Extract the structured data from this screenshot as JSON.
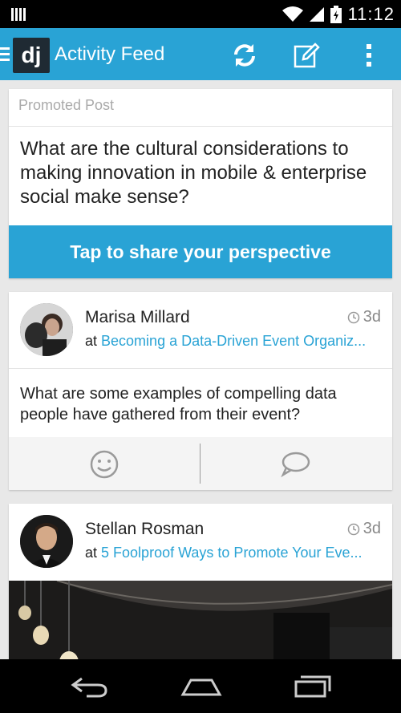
{
  "status_bar": {
    "time": "11:12",
    "icons": [
      "signal-bars-icon",
      "wifi-icon",
      "cellular-signal-icon",
      "battery-icon"
    ]
  },
  "app_bar": {
    "title": "Activity Feed",
    "logo_text": "dj",
    "icons": [
      "menu-icon",
      "refresh-icon",
      "compose-icon",
      "overflow-menu-icon"
    ],
    "accent_color": "#29a3d5"
  },
  "promoted": {
    "label": "Promoted Post",
    "question": "What are the cultural considerations to making innovation in mobile & enterprise social make sense?",
    "cta_label": "Tap to share your perspective"
  },
  "posts": [
    {
      "author": "Marisa Millard",
      "time": "3d",
      "at_prefix": "at",
      "event": "Becoming a Data-Driven Event Organiz...",
      "text": "What are some examples of compelling data people have gathered from their event?",
      "actions": [
        "smile-icon",
        "comment-icon"
      ]
    },
    {
      "author": "Stellan Rosman",
      "time": "3d",
      "at_prefix": "at",
      "event": "5 Foolproof Ways to Promote Your Eve..."
    }
  ],
  "nav_bar": {
    "icons": [
      "back-icon",
      "home-icon",
      "recent-apps-icon"
    ]
  }
}
